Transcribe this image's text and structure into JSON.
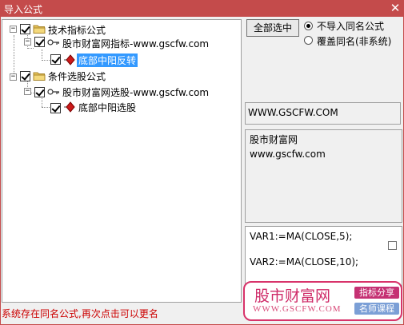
{
  "window": {
    "title": "导入公式",
    "close_glyph": "✕"
  },
  "tree": {
    "groups": [
      {
        "label": "技术指标公式",
        "checked": true,
        "collection": {
          "label": "股市财富网指标-www.gscfw.com",
          "checked": true,
          "formula": {
            "label": "底部中阳反转",
            "checked": true,
            "selected": true
          }
        }
      },
      {
        "label": "条件选股公式",
        "checked": true,
        "collection": {
          "label": "股市财富网选股-www.gscfw.com",
          "checked": true,
          "formula": {
            "label": "底部中阳选股",
            "checked": true,
            "selected": false
          }
        }
      }
    ],
    "collapse_glyph": "−"
  },
  "options": {
    "select_all_label": "全部选中",
    "radio_skip_label": "不导入同名公式",
    "radio_overwrite_label": "覆盖同名(非系统)",
    "selected_radio": "skip"
  },
  "info": {
    "text": "WWW.GSCFW.COM"
  },
  "description": {
    "line1": "股市财富网",
    "line2": "www.gscfw.com"
  },
  "code": {
    "line1": "VAR1:=MA(CLOSE,5);",
    "line2": "VAR2:=MA(CLOSE,10);"
  },
  "watermark": {
    "site_name": "股市财富网",
    "domain": "WWW.GSCFW.COM",
    "tag1": "指标分享",
    "tag2": "名师课程"
  },
  "status": {
    "text": "系统存在同名公式,再次点击可以更名"
  },
  "colors": {
    "titlebar": "#c44b4b",
    "selection": "#3399ff",
    "status_text": "#cc0000",
    "watermark_pink": "#d8336a"
  }
}
